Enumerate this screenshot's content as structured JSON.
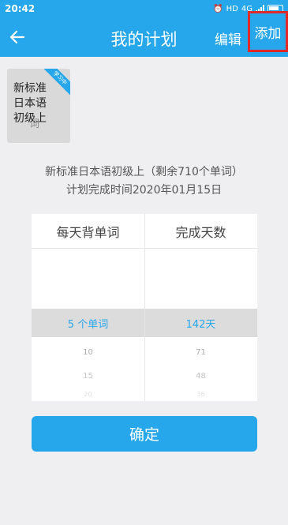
{
  "status_bar": {
    "time": "20:42",
    "hd_label": "HD",
    "network": "4G"
  },
  "header": {
    "title": "我的计划",
    "edit_label": "编辑",
    "add_label": "添加",
    "accent_color": "#27a7eb",
    "highlight_box_color": "#e02a2a"
  },
  "book": {
    "title_line1": "新标准",
    "title_line2": "日本语",
    "title_line3": "初级上",
    "overlay_text": "词",
    "ribbon_text": "学习中"
  },
  "plan_info": {
    "line1": "新标准日本语初级上（剩余710个单词）",
    "line2": "计划完成时间2020年01月15日"
  },
  "picker": {
    "left_header": "每天背单词",
    "right_header": "完成天数",
    "selected_left": "5  个单词",
    "selected_right": "142天",
    "left_rows": [
      "10",
      "15",
      "20"
    ],
    "right_rows": [
      "71",
      "48",
      "36"
    ]
  },
  "confirm_label": "确定"
}
